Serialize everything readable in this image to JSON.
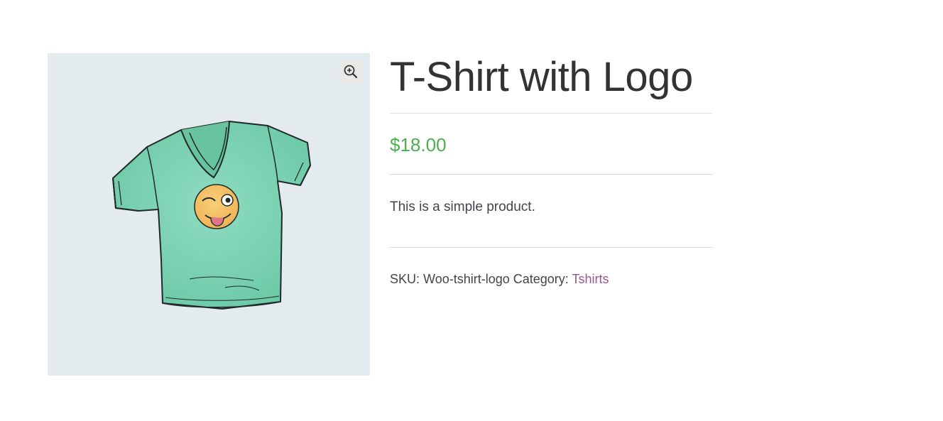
{
  "product": {
    "title": "T-Shirt with Logo",
    "price": "$18.00",
    "description": "This is a simple product.",
    "sku_label": "SKU:",
    "sku_value": "Woo-tshirt-logo",
    "category_label": "Category:",
    "category_value": "Tshirts"
  },
  "gallery": {
    "zoom_icon": "zoom-in-icon",
    "image_subject": "t-shirt-with-logo-image"
  },
  "colors": {
    "price": "#4caf50",
    "link": "#96588a",
    "gallery_bg": "#e4ebee",
    "shirt": "#7fd3b3"
  }
}
